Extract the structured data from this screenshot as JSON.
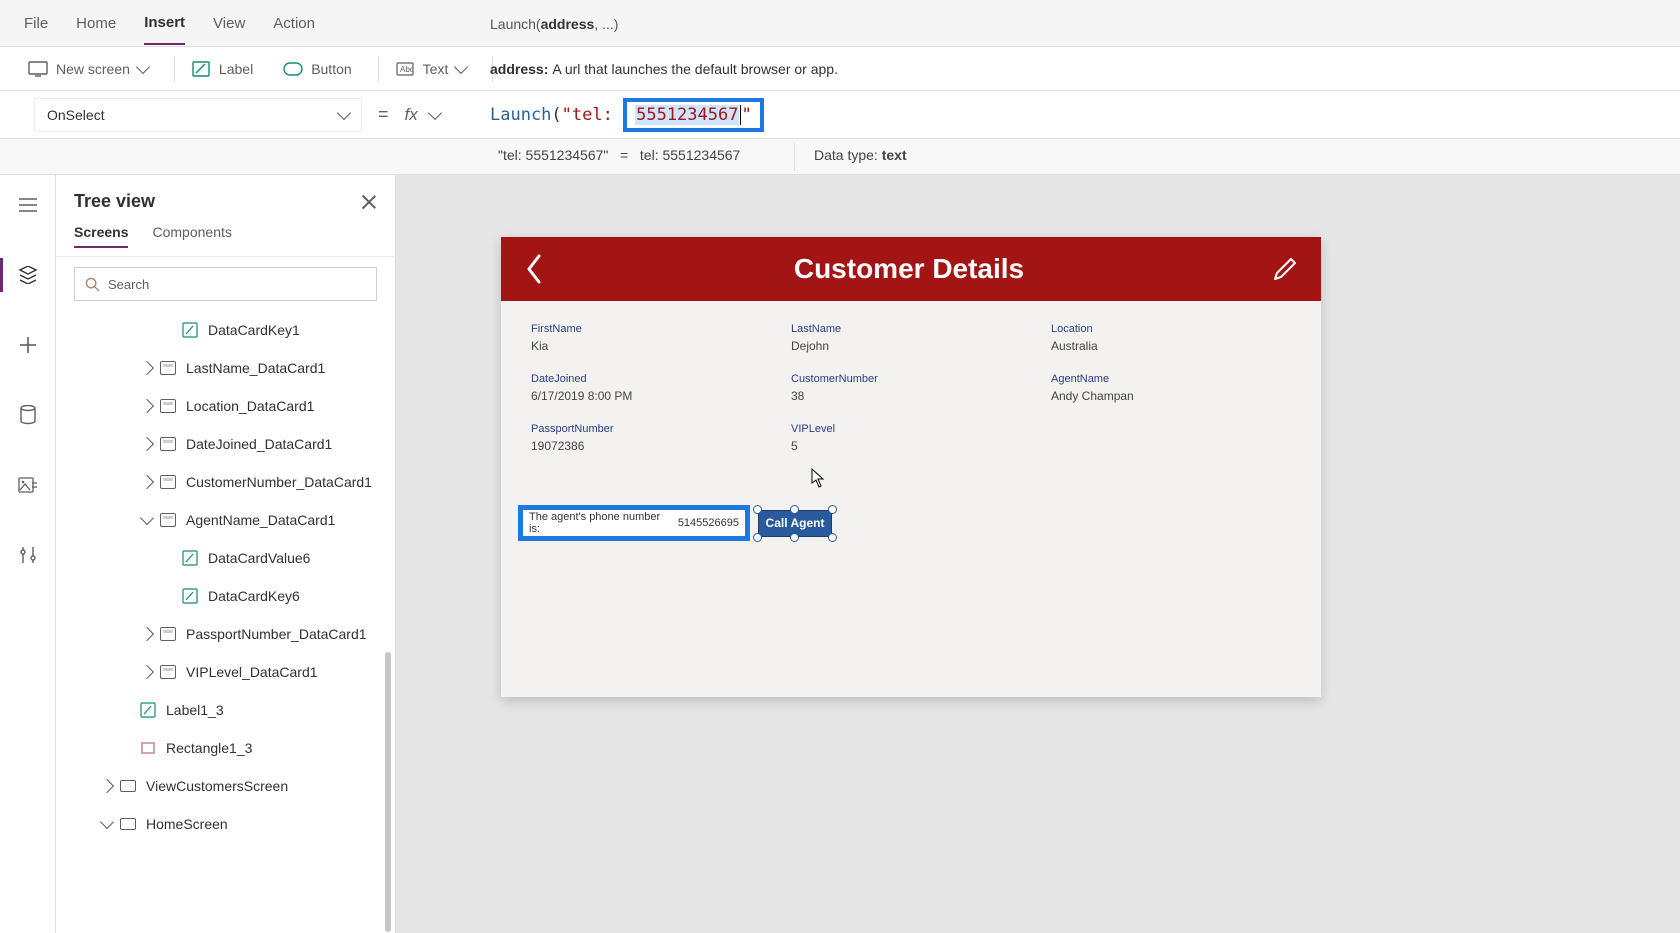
{
  "menu": {
    "file": "File",
    "home": "Home",
    "insert": "Insert",
    "view": "View",
    "action": "Action"
  },
  "signature": {
    "fn": "Launch(",
    "arg": "address",
    "rest": ", ...)"
  },
  "paramHelp": {
    "name": "address:",
    "desc": "A url that launches the default browser or app."
  },
  "ribbon": {
    "newScreen": "New screen",
    "label": "Label",
    "button": "Button",
    "text": "Text"
  },
  "property": {
    "selected": "OnSelect"
  },
  "formula": {
    "fn": "Launch",
    "open": "(",
    "pre": "\"tel",
    "highlighted": "5551234567",
    "post": "\""
  },
  "evaluation": {
    "quoted": "\"tel: 5551234567\"",
    "eq": "=",
    "resolved": "tel: 5551234567",
    "dtLabel": "Data type:",
    "dtValue": "text"
  },
  "treeview": {
    "title": "Tree view",
    "tabs": {
      "screens": "Screens",
      "components": "Components"
    },
    "searchPlaceholder": "Search",
    "items": {
      "dataCardKey1": "DataCardKey1",
      "lastName": "LastName_DataCard1",
      "location": "Location_DataCard1",
      "dateJoined": "DateJoined_DataCard1",
      "customerNumber": "CustomerNumber_DataCard1",
      "agentName": "AgentName_DataCard1",
      "dataCardValue6": "DataCardValue6",
      "dataCardKey6": "DataCardKey6",
      "passportNumber": "PassportNumber_DataCard1",
      "vipLevel": "VIPLevel_DataCard1",
      "label1_3": "Label1_3",
      "rectangle1_3": "Rectangle1_3",
      "viewCustomersScreen": "ViewCustomersScreen",
      "homeScreen": "HomeScreen"
    }
  },
  "canvas": {
    "header": "Customer Details",
    "fields": {
      "firstName": {
        "label": "FirstName",
        "value": "Kia"
      },
      "lastName": {
        "label": "LastName",
        "value": "Dejohn"
      },
      "location": {
        "label": "Location",
        "value": "Australia"
      },
      "dateJoined": {
        "label": "DateJoined",
        "value": "6/17/2019 8:00 PM"
      },
      "customerNumber": {
        "label": "CustomerNumber",
        "value": "38"
      },
      "agentName": {
        "label": "AgentName",
        "value": "Andy Champan"
      },
      "passportNumber": {
        "label": "PassportNumber",
        "value": "19072386"
      },
      "vipLevel": {
        "label": "VIPLevel",
        "value": "5"
      }
    },
    "agentLabel": {
      "text": "The agent's phone number is:",
      "number": "5145526695"
    },
    "callButton": "Call Agent"
  }
}
